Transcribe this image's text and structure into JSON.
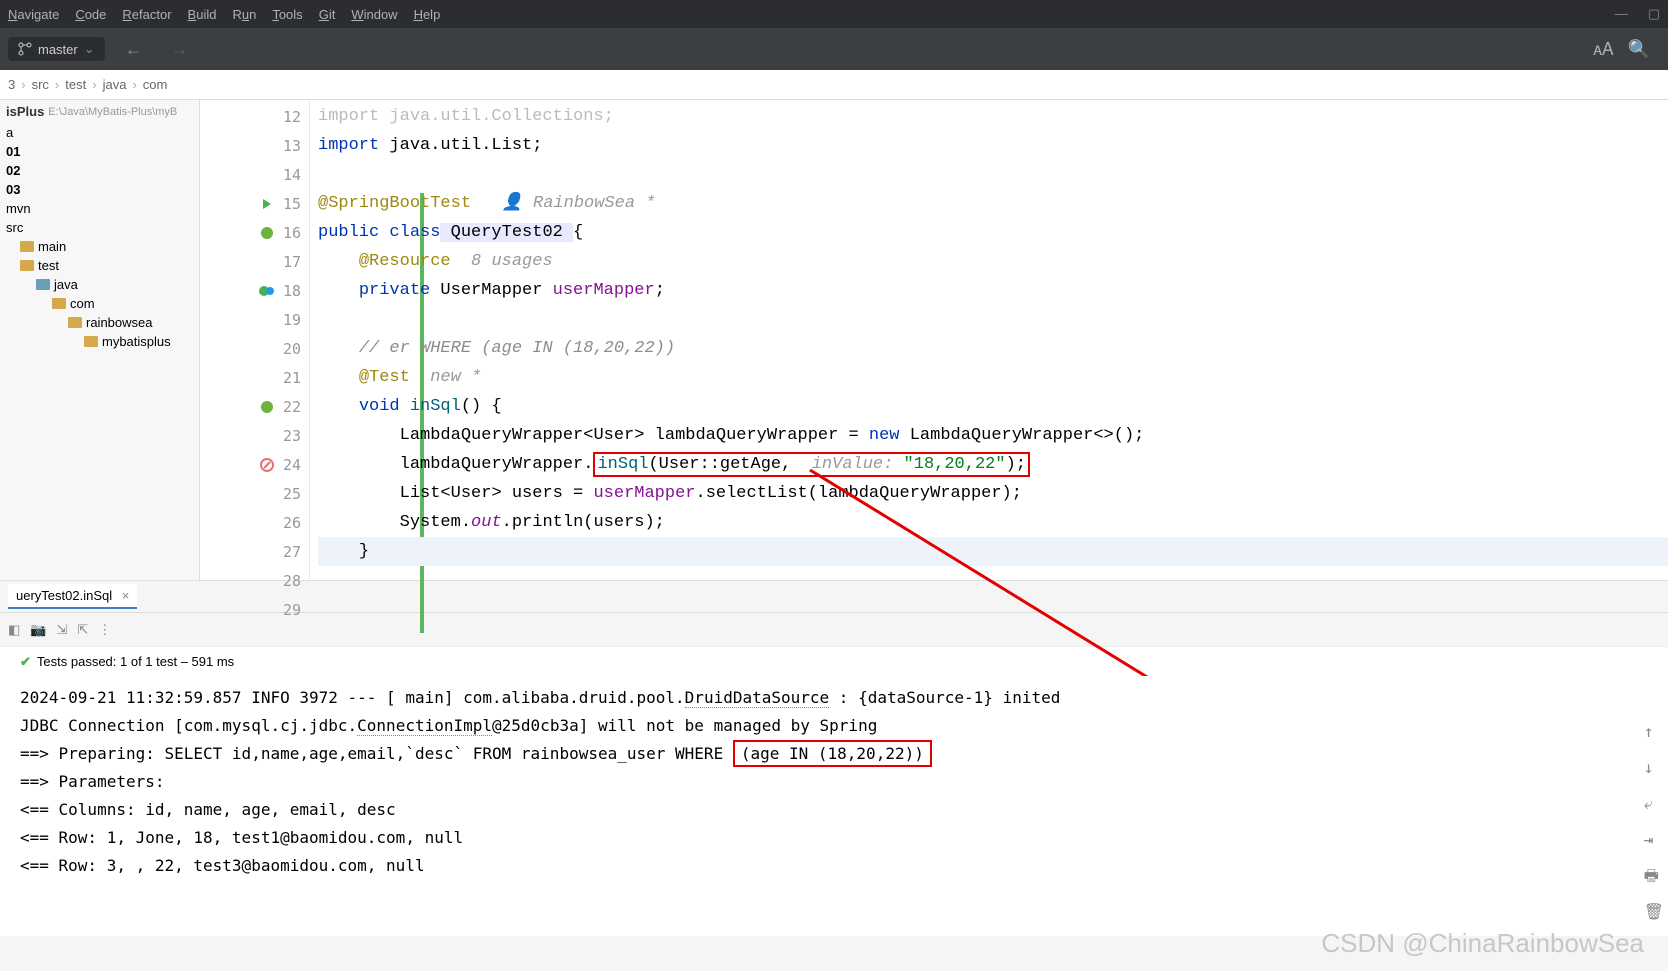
{
  "menu": [
    "Navigate",
    "Code",
    "Refactor",
    "Build",
    "Run",
    "Tools",
    "Git",
    "Window",
    "Help"
  ],
  "branch": "master",
  "breadcrumb": [
    "3",
    "src",
    "test",
    "java",
    "com"
  ],
  "project_root": "isPlus",
  "project_path": "E:\\Java\\MyBatis-Plus\\myB",
  "tree": [
    "a",
    "01",
    "02",
    "03",
    "mvn",
    "src",
    "main",
    "test",
    "java",
    "com",
    "rainbowsea",
    "mybatisplus"
  ],
  "bottom_tab": "ueryTest02.inSql",
  "tests_status": "Tests passed: 1 of 1 test – 591 ms",
  "author_hint": "RainbowSea *",
  "usages_hint": "8 usages",
  "new_hint": "new *",
  "code_lines": {
    "l12": "import java.util.Collections;",
    "l13_a": "import",
    "l13_b": " java.util.List;",
    "l15_a": "@SpringBootTest",
    "l16_a": "public class",
    "l16_b": " QueryTest02 ",
    "l16_c": "{",
    "l17_a": "@Resource",
    "l18_a": "private",
    "l18_b": " UserMapper ",
    "l18_c": "userMapper",
    "l18_d": ";",
    "l20_a": "// er WHERE (age IN (18,20,22))",
    "l21_a": "@Test",
    "l22_a": "void",
    "l22_b": " inSql",
    "l22_c": "() {",
    "l23_a": "LambdaQueryWrapper<User> lambdaQueryWrapper = ",
    "l23_b": "new",
    "l23_c": " LambdaQueryWrapper<>();",
    "l24_a": "lambdaQueryWrapper.",
    "l24_b": "inSql",
    "l24_c": "(User::getAge,  ",
    "l24_hint": "inValue:",
    "l24_d": " \"18,20,22\"",
    "l24_e": ");",
    "l25_a": "List<User> users = ",
    "l25_b": "userMapper",
    "l25_c": ".selectList(lambdaQueryWrapper);",
    "l26_a": "System.",
    "l26_b": "out",
    "l26_c": ".println(users);",
    "l27_a": "}"
  },
  "line_numbers": [
    "12",
    "13",
    "14",
    "15",
    "16",
    "17",
    "18",
    "19",
    "20",
    "21",
    "22",
    "23",
    "24",
    "25",
    "26",
    "27",
    "28",
    "29"
  ],
  "console": {
    "l1_a": "2024-09-21 11:32:59.857  INFO 3972 --- [           main] com.alibaba.druid.pool.",
    "l1_b": "DruidDataSource",
    "l1_c": "   : {dataSource-1} inited",
    "l2_a": "JDBC Connection [com.mysql.cj.jdbc.",
    "l2_b": "ConnectionImpl",
    "l2_c": "@25d0cb3a] will not be managed by Spring",
    "l3_a": "==>  Preparing: SELECT id,name,age,email,`desc` FROM rainbowsea_user WHERE ",
    "l3_b": "(age IN (18,20,22))",
    "l4": "==> Parameters: ",
    "l5": "<==    Columns: id, name, age, email, desc",
    "l6": "<==        Row: 1, Jone, 18, test1@baomidou.com, null",
    "l7": "<==        Row: 3, , 22, test3@baomidou.com, null"
  },
  "watermark": "CSDN @ChinaRainbowSea"
}
